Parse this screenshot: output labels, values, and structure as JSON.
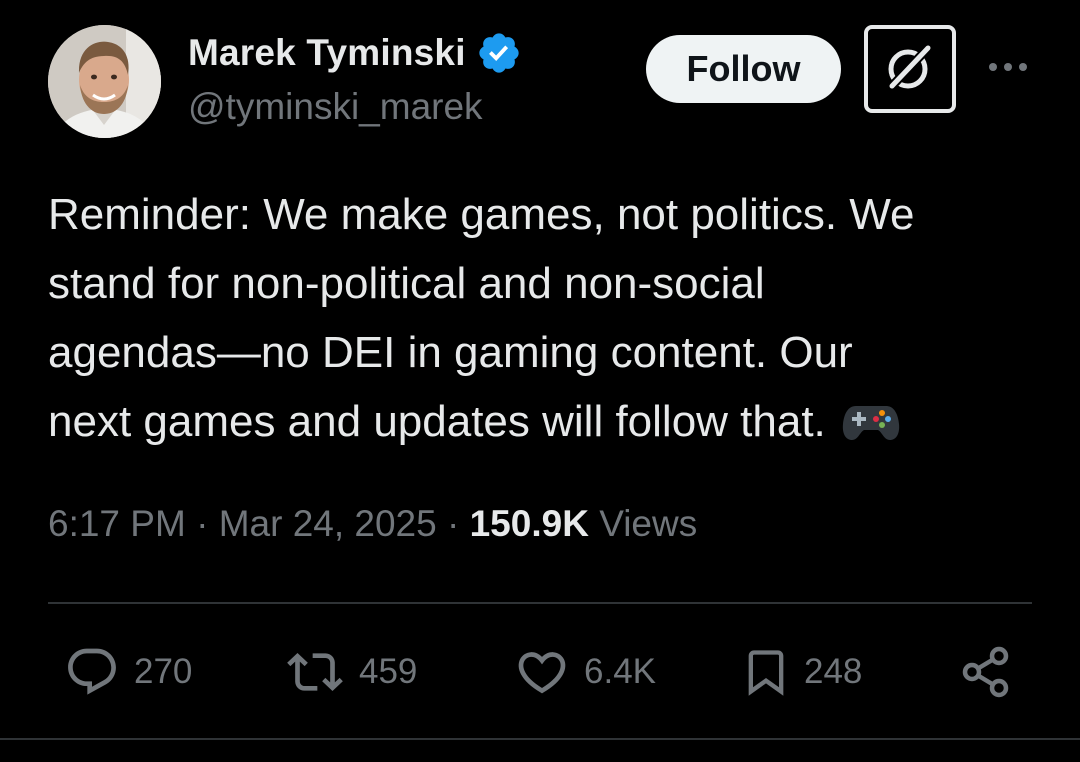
{
  "author": {
    "display_name": "Marek Tyminski",
    "handle": "@tyminski_marek",
    "verified": true,
    "verified_color": "#1d9bf0"
  },
  "header": {
    "follow_label": "Follow",
    "grok_icon": "grok-slash-icon",
    "more_icon": "more-dots-icon"
  },
  "tweet": {
    "lines": [
      "Reminder: We make games, not politics. We",
      "stand for non-political and non-social",
      "agendas—no DEI in gaming content. Our",
      "next games and updates will follow that."
    ],
    "emoji": "gamepad-icon"
  },
  "meta": {
    "time": "6:17 PM",
    "separator": "·",
    "date": "Mar 24, 2025",
    "views_count": "150.9K",
    "views_label": "Views"
  },
  "actions": {
    "replies": "270",
    "reposts": "459",
    "likes": "6.4K",
    "bookmarks": "248"
  },
  "colors": {
    "background": "#000000",
    "text_primary": "#e7e9ea",
    "text_secondary": "#71767b",
    "divider": "#2f3336",
    "follow_bg": "#eff3f4"
  }
}
